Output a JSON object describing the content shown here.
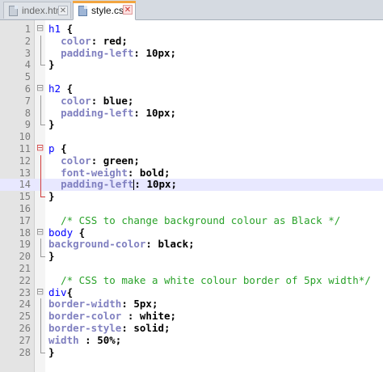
{
  "tabs": [
    {
      "label": "index.html",
      "active": false,
      "close": "✕"
    },
    {
      "label": "style.css",
      "active": true,
      "close": "✕"
    }
  ],
  "lines": [
    {
      "n": "1",
      "fold": "open",
      "parts": [
        [
          "sel",
          "h1 "
        ],
        [
          "brace",
          "{"
        ]
      ]
    },
    {
      "n": "2",
      "fold": "mid",
      "parts": [
        [
          "txt",
          "  "
        ],
        [
          "prop",
          "color"
        ],
        [
          "colon",
          ": "
        ],
        [
          "val",
          "red;"
        ]
      ]
    },
    {
      "n": "3",
      "fold": "mid",
      "parts": [
        [
          "txt",
          "  "
        ],
        [
          "prop",
          "padding-left"
        ],
        [
          "colon",
          ": "
        ],
        [
          "val",
          "10px;"
        ]
      ]
    },
    {
      "n": "4",
      "fold": "end",
      "parts": [
        [
          "brace",
          "}"
        ]
      ]
    },
    {
      "n": "5",
      "fold": "",
      "parts": []
    },
    {
      "n": "6",
      "fold": "open",
      "parts": [
        [
          "sel",
          "h2 "
        ],
        [
          "brace",
          "{"
        ]
      ]
    },
    {
      "n": "7",
      "fold": "mid",
      "parts": [
        [
          "txt",
          "  "
        ],
        [
          "prop",
          "color"
        ],
        [
          "colon",
          ": "
        ],
        [
          "val",
          "blue;"
        ]
      ]
    },
    {
      "n": "8",
      "fold": "mid",
      "parts": [
        [
          "txt",
          "  "
        ],
        [
          "prop",
          "padding-left"
        ],
        [
          "colon",
          ": "
        ],
        [
          "val",
          "10px;"
        ]
      ]
    },
    {
      "n": "9",
      "fold": "end",
      "parts": [
        [
          "brace",
          "}"
        ]
      ]
    },
    {
      "n": "10",
      "fold": "",
      "parts": []
    },
    {
      "n": "11",
      "fold": "open-red",
      "parts": [
        [
          "sel",
          "p "
        ],
        [
          "brace",
          "{"
        ]
      ]
    },
    {
      "n": "12",
      "fold": "mid-red",
      "parts": [
        [
          "txt",
          "  "
        ],
        [
          "prop",
          "color"
        ],
        [
          "colon",
          ": "
        ],
        [
          "val",
          "green;"
        ]
      ]
    },
    {
      "n": "13",
      "fold": "mid-red",
      "parts": [
        [
          "txt",
          "  "
        ],
        [
          "prop",
          "font-weight"
        ],
        [
          "colon",
          ": "
        ],
        [
          "val",
          "bold;"
        ]
      ]
    },
    {
      "n": "14",
      "fold": "mid-red",
      "current": true,
      "parts": [
        [
          "txt",
          "  "
        ],
        [
          "prop",
          "padding-left"
        ],
        [
          "caret",
          ""
        ],
        [
          "colon",
          ": "
        ],
        [
          "val",
          "10px;"
        ]
      ]
    },
    {
      "n": "15",
      "fold": "end-red",
      "parts": [
        [
          "brace",
          "}"
        ]
      ]
    },
    {
      "n": "16",
      "fold": "",
      "parts": []
    },
    {
      "n": "17",
      "fold": "",
      "parts": [
        [
          "txt",
          "  "
        ],
        [
          "cmt",
          "/* CSS to change background colour as Black */"
        ]
      ]
    },
    {
      "n": "18",
      "fold": "open",
      "parts": [
        [
          "sel",
          "body "
        ],
        [
          "brace",
          "{"
        ]
      ]
    },
    {
      "n": "19",
      "fold": "mid",
      "parts": [
        [
          "prop",
          "background-color"
        ],
        [
          "colon",
          ": "
        ],
        [
          "val",
          "black;"
        ]
      ]
    },
    {
      "n": "20",
      "fold": "end",
      "parts": [
        [
          "brace",
          "}"
        ]
      ]
    },
    {
      "n": "21",
      "fold": "",
      "parts": []
    },
    {
      "n": "22",
      "fold": "",
      "parts": [
        [
          "txt",
          "  "
        ],
        [
          "cmt",
          "/* CSS to make a white colour border of 5px width*/"
        ]
      ]
    },
    {
      "n": "23",
      "fold": "open",
      "parts": [
        [
          "sel",
          "div"
        ],
        [
          "brace",
          "{"
        ]
      ]
    },
    {
      "n": "24",
      "fold": "mid",
      "parts": [
        [
          "prop",
          "border-width"
        ],
        [
          "colon",
          ": "
        ],
        [
          "val",
          "5px;"
        ]
      ]
    },
    {
      "n": "25",
      "fold": "mid",
      "parts": [
        [
          "prop",
          "border-color"
        ],
        [
          "colon",
          " : "
        ],
        [
          "val",
          "white;"
        ]
      ]
    },
    {
      "n": "26",
      "fold": "mid",
      "parts": [
        [
          "prop",
          "border-style"
        ],
        [
          "colon",
          ": "
        ],
        [
          "val",
          "solid;"
        ]
      ]
    },
    {
      "n": "27",
      "fold": "mid",
      "parts": [
        [
          "prop",
          "width"
        ],
        [
          "colon",
          " : "
        ],
        [
          "val",
          "50%;"
        ]
      ]
    },
    {
      "n": "28",
      "fold": "end",
      "parts": [
        [
          "brace",
          "}"
        ]
      ]
    }
  ],
  "colors": {
    "selector": "#0000ff",
    "property": "#8080c0",
    "comment": "#2aa22a",
    "current_line": "#e8e8ff",
    "active_tab_accent": "#f2a540"
  },
  "icons": {
    "file": "file-icon",
    "close": "close-icon",
    "fold": "fold-marker-icon"
  }
}
